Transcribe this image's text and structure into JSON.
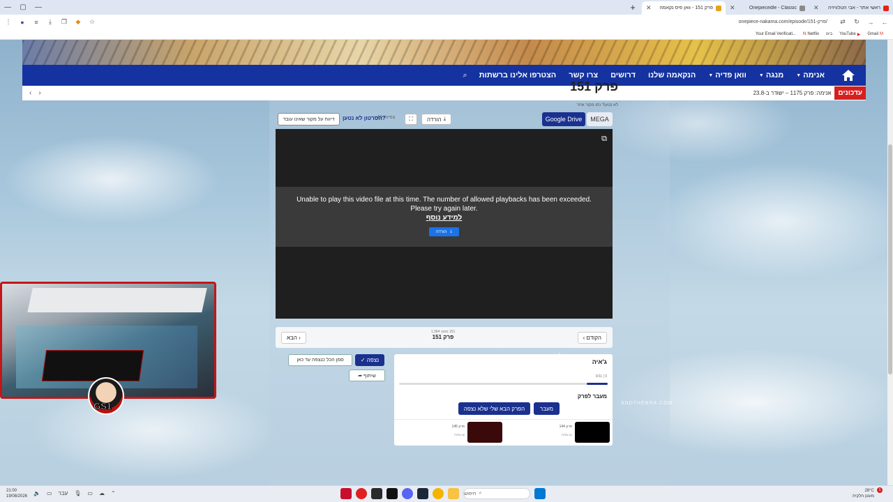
{
  "browser": {
    "tabs": [
      {
        "label": "ראשי אתר - אבי הטלוויזיה",
        "active": false
      },
      {
        "label": "Onepiecedle - Classic",
        "active": false
      },
      {
        "label": "פרק 151 - וואן פיס נקאמה",
        "active": true
      }
    ],
    "new_tab": "+",
    "url": "onepiece-nakama.com/episode/151-פרק/",
    "bookmarks": [
      "Gmail",
      "YouTube",
      "ביגו",
      "Netflix",
      "Your Email Verificati..."
    ]
  },
  "site": {
    "nav": {
      "items": [
        {
          "label": "אנימה",
          "caret": true
        },
        {
          "label": "מנגה",
          "caret": true
        },
        {
          "label": "וואן פדיה",
          "caret": true
        },
        {
          "label": "הנקאמה שלנו",
          "caret": false
        },
        {
          "label": "דרושים",
          "caret": false
        },
        {
          "label": "צרו קשר",
          "caret": false
        },
        {
          "label": "הצטרפו אלינו ברשתות",
          "caret": false
        }
      ]
    },
    "updates": {
      "label": "עדכונים",
      "text": "אנימה: פרק 1175 – ישודר ב-23.8"
    }
  },
  "episode": {
    "title": "פרק 151",
    "subtitle": "לא נטען? נסו מקור אחר",
    "sources": {
      "google_drive": "Google Drive",
      "mega": "MEGA"
    },
    "download_label": "הורדה",
    "views": "40 צפיות",
    "not_working": "הסרטון לא נטען?",
    "report_label": "דיווח על מקור שאינו עובד",
    "player": {
      "error_message": "Unable to play this video file at this time. The number of allowed playbacks has been exceeded. Please try again later.",
      "more_info": "למידע נוסף",
      "download_button": "הורדה"
    },
    "nav": {
      "prev": "‹ הקודם",
      "next": "הבא ›",
      "position": "151 מתוך 1,364",
      "current": "פרק 151"
    },
    "watched": "✓ נצפה",
    "mark_all": "סמן הכל כנצפה עד כאן",
    "share": "➦ שיתוף"
  },
  "arc": {
    "name": "ג'איה",
    "progress_text": "0/11 | 0",
    "progress": 0.1,
    "jump_label": "מעבר לפרק",
    "move_button": "מעבר",
    "next_unwatched": "הפרק הבא שלי שלא נצפה",
    "cards": [
      {
        "label": "פרק 144",
        "sub": "54 צפיות"
      },
      {
        "label": "פרק 145",
        "sub": "46 צפיות"
      }
    ]
  },
  "watermark": "ANDTHEBRA.COM",
  "streamer_tag": "GS1",
  "taskbar": {
    "time": "21:00",
    "date": "19/08/2026",
    "lang": "עבר",
    "search_placeholder": "חיפוש",
    "temp": "28°C",
    "weather_text": "מעונן חלקית",
    "notifications": "1"
  },
  "colors": {
    "nav_bg": "#1432a0",
    "accent": "#1a318f",
    "alert": "#d62020"
  }
}
